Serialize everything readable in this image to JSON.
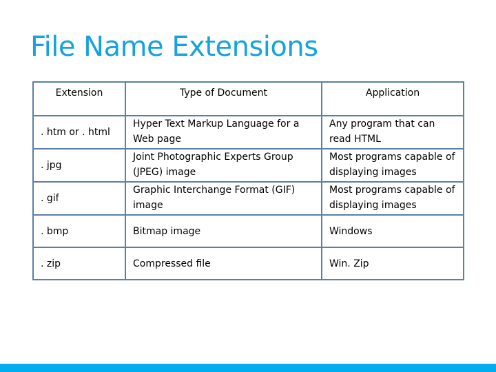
{
  "slide": {
    "title": "File Name Extensions",
    "accent_color": "#16a2dd",
    "bar_color": "#00adef"
  },
  "table": {
    "headers": [
      "Extension",
      "Type of Document",
      "Application"
    ],
    "rows": [
      {
        "extension": ". htm or . html",
        "type": "Hyper Text Markup Language for a Web page",
        "application": "Any program that can read HTML"
      },
      {
        "extension": ". jpg",
        "type": "Joint Photographic Experts Group (JPEG) image",
        "application": "Most programs capable of displaying images"
      },
      {
        "extension": ". gif",
        "type": "Graphic Interchange Format (GIF) image",
        "application": "Most programs capable of displaying images"
      },
      {
        "extension": ". bmp",
        "type": "Bitmap image",
        "application": "Windows"
      },
      {
        "extension": ". zip",
        "type": "Compressed file",
        "application": "Win. Zip"
      }
    ]
  }
}
